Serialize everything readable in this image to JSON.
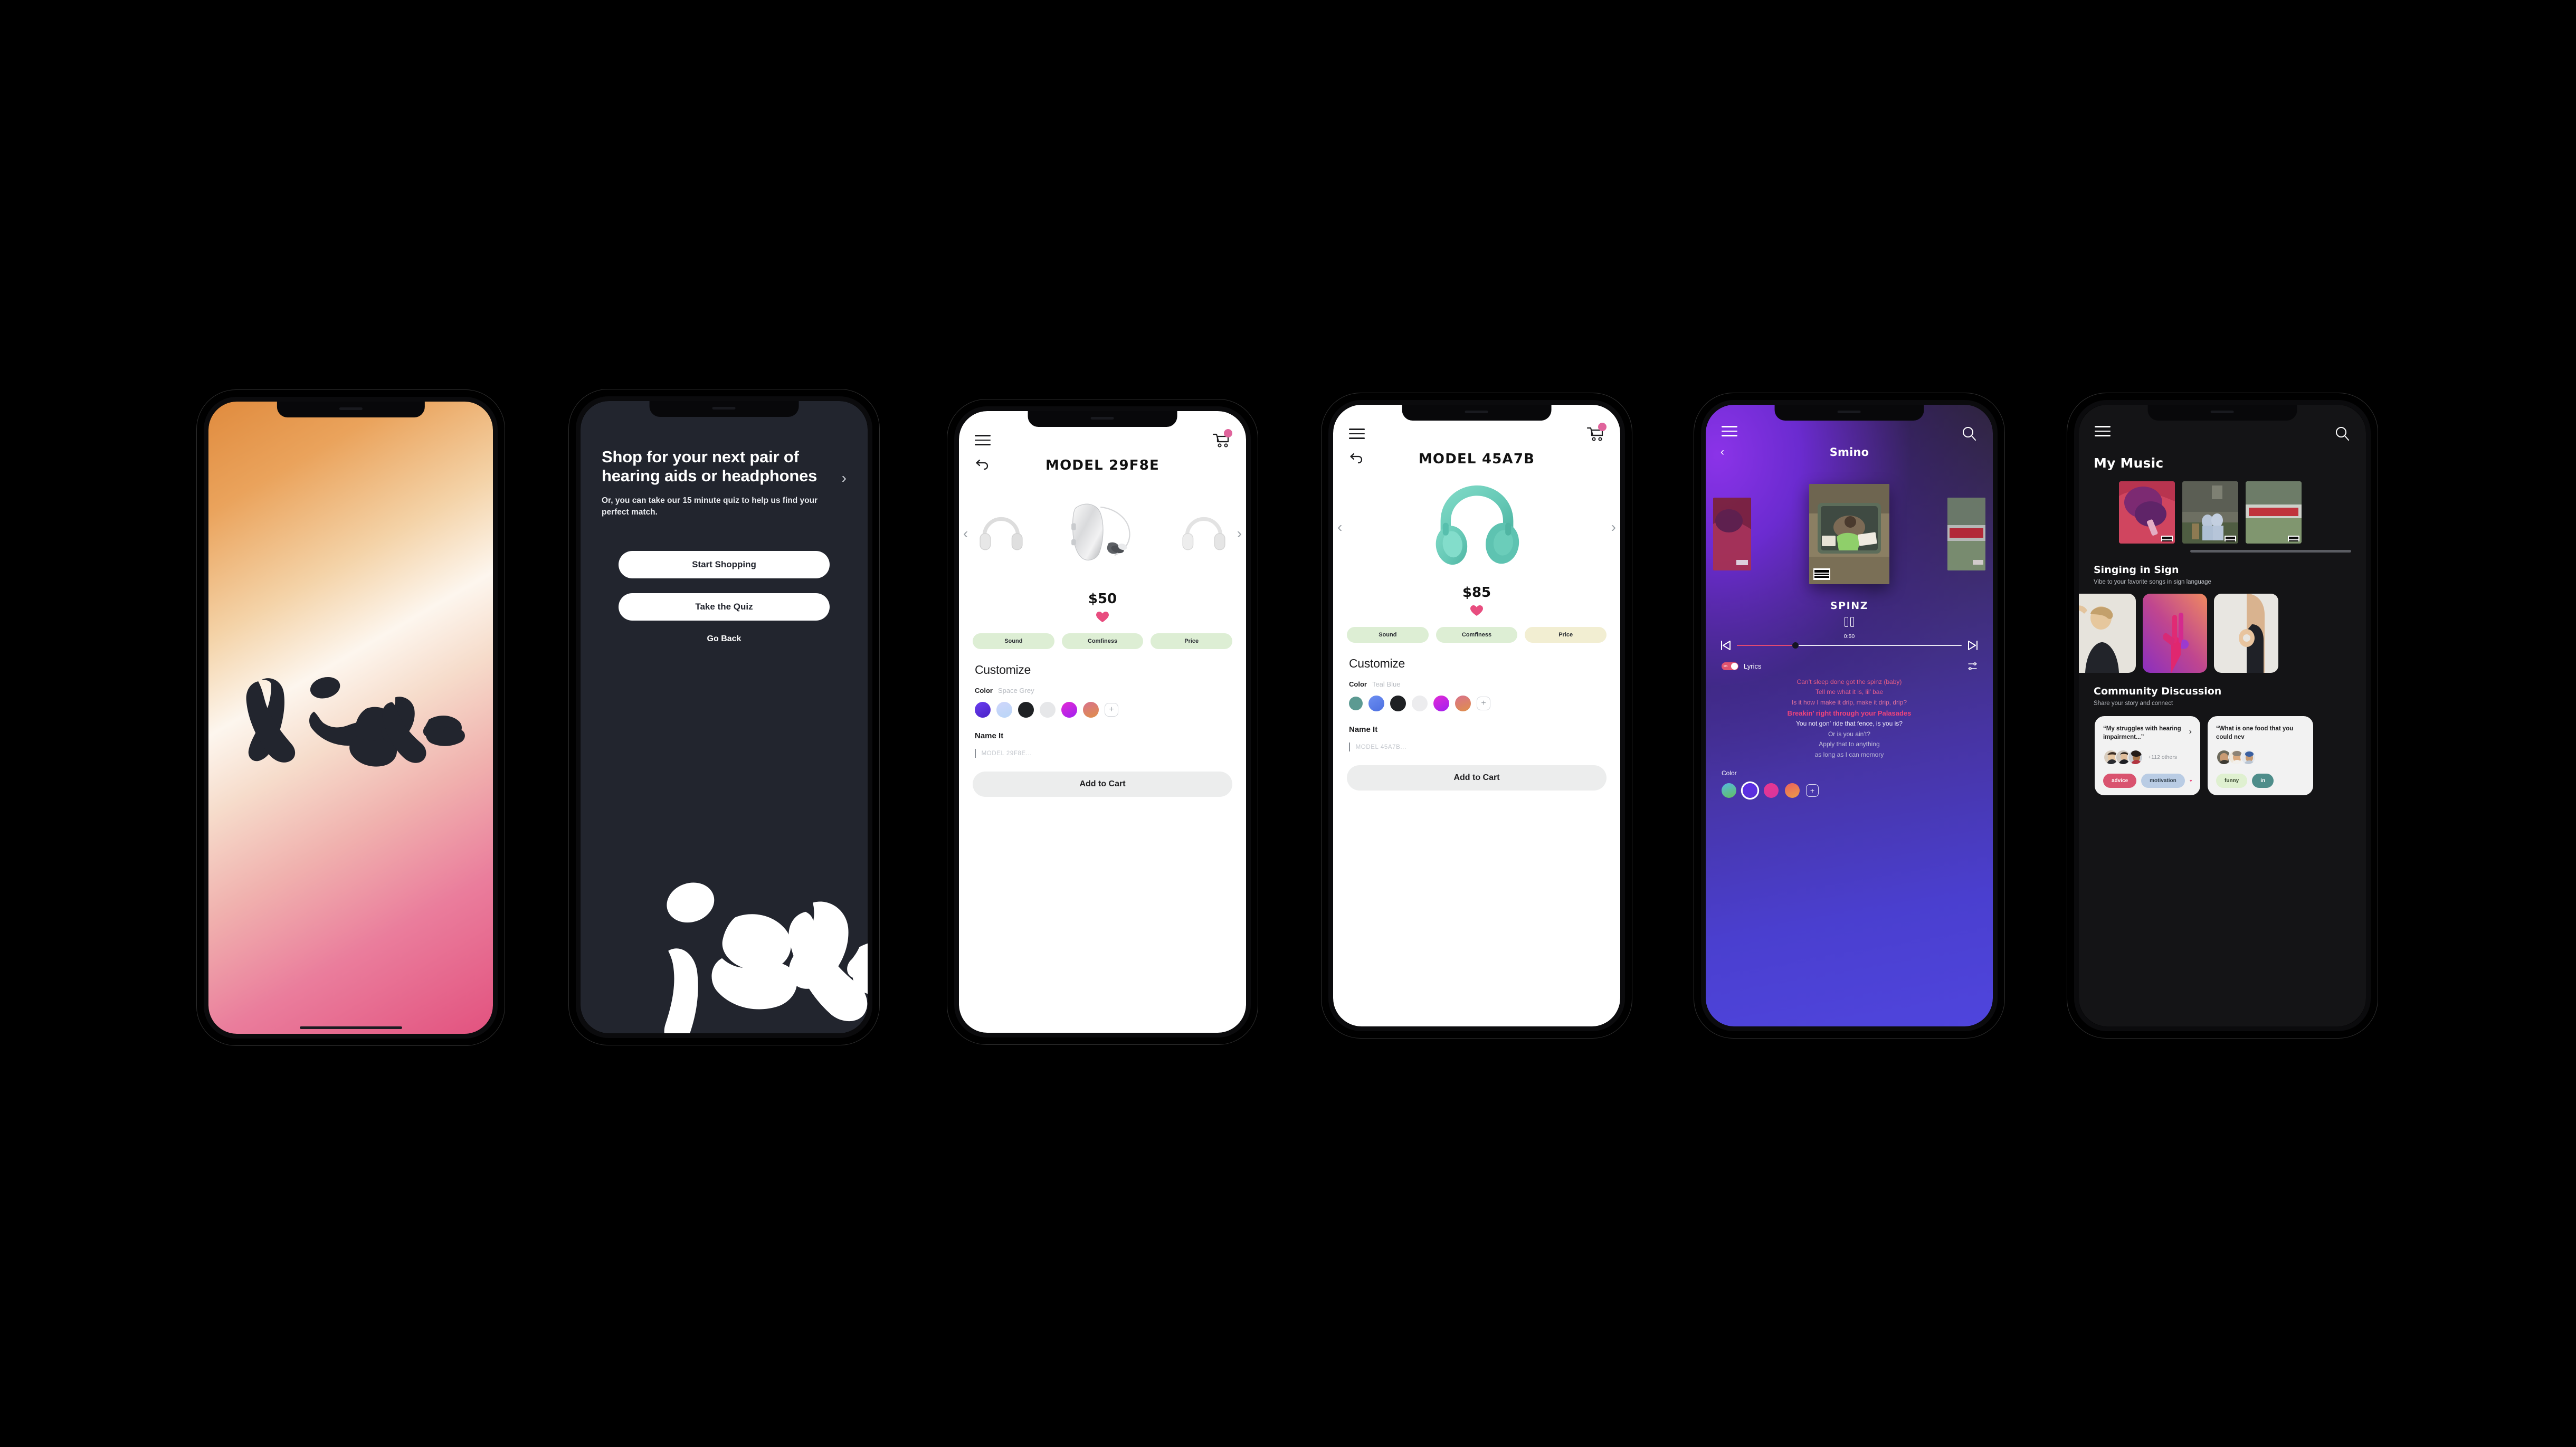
{
  "background_color": "#000000",
  "brand": {
    "logo_name": "vibe-wordmark-logo"
  },
  "phone1": {
    "name": "splash-screen",
    "gradient": [
      "#e08b3e",
      "#f4d3a8",
      "#fdf6ee",
      "#ea7d9c",
      "#e2527f"
    ],
    "logo_alt": "vibe"
  },
  "phone2": {
    "name": "onboarding-screen",
    "background": "#22252e",
    "title": "Shop for your next pair of hearing aids or headphones",
    "subtitle": "Or, you can take our 15 minute quiz to help us find your perfect match.",
    "primary_button": "Start Shopping",
    "secondary_button": "Take the Quiz",
    "tertiary_link": "Go Back",
    "chevron": "›"
  },
  "phone3": {
    "name": "product-detail-hearing-aid",
    "model_title": "MODEL 29F8E",
    "price": "$50",
    "cart_badge_color": "#e0649c",
    "heart_color": "#e84d7f",
    "feature_pills": [
      {
        "label": "Sound",
        "color": "#ddeed4"
      },
      {
        "label": "Comfiness",
        "color": "#ddeed4"
      },
      {
        "label": "Price",
        "color": "#ddeed4"
      }
    ],
    "customize_heading": "Customize",
    "color_label": "Color",
    "color_value": "Space Grey",
    "swatches": [
      "#5b31d8",
      "#c3cdf7",
      "#1f2124",
      "#e6e7e9",
      "#cf2ad8",
      "#d46f7a"
    ],
    "add_swatch_glyph": "+",
    "name_it_label": "Name It",
    "name_it_placeholder": "MODEL 29F8E...",
    "add_to_cart": "Add to Cart"
  },
  "phone4": {
    "name": "product-detail-headphones",
    "model_title": "MODEL 45A7B",
    "price": "$85",
    "cart_badge_color": "#e0649c",
    "heart_color": "#e84d7f",
    "feature_pills": [
      {
        "label": "Sound",
        "color": "#ddeed4"
      },
      {
        "label": "Comfiness",
        "color": "#ddeed4"
      },
      {
        "label": "Price",
        "color": "#f2eed2"
      }
    ],
    "customize_heading": "Customize",
    "color_label": "Color",
    "color_value": "Teal Blue",
    "swatches": [
      "#5c9a92",
      "#5b7ce8",
      "#1f2124",
      "#ececee",
      "#cf2ad8",
      "#d46f7a"
    ],
    "add_swatch_glyph": "+",
    "name_it_label": "Name It",
    "name_it_placeholder": "MODEL 45A7B...",
    "add_to_cart": "Add to Cart"
  },
  "phone5": {
    "name": "music-player-screen",
    "artist": "Smino",
    "track": "SPINZ",
    "current_time": "0:50",
    "progress_percent": 26,
    "lyrics_toggle_label": "Lyrics",
    "lyrics_toggle_state": "On",
    "lyrics": [
      {
        "text": "Can’t sleep done got the spinz (baby)",
        "style": "pink"
      },
      {
        "text": "Tell me what it is, lil’ bae",
        "style": "pink"
      },
      {
        "text": "Is it how I make it drip, make it drip, drip?",
        "style": "pink-soft"
      },
      {
        "text": "Breakin’ right through your Palasades",
        "style": "active"
      },
      {
        "text": "You not gon’ ride that fence, is you is?",
        "style": "white"
      },
      {
        "text": "Or is you ain’t?",
        "style": "dim"
      },
      {
        "text": "Apply that to anything",
        "style": "dim"
      },
      {
        "text": "as long as I can memory",
        "style": "dim"
      }
    ],
    "color_label": "Color",
    "swatches": [
      "#4fb0d8",
      "#5b31d8",
      "#e8368f",
      "#e97a54"
    ],
    "add_swatch_glyph": "+",
    "transport": {
      "prev": "skip-back",
      "play": "pause",
      "next": "skip-forward"
    }
  },
  "phone6": {
    "name": "my-music-screen",
    "page_title": "My Music",
    "section2_title": "Singing in Sign",
    "section2_subtitle": "Vibe to your favorite songs in sign language",
    "section3_title": "Community Discussion",
    "section3_subtitle": "Share your story and connect",
    "discussion_cards": [
      {
        "quote": "“My struggles with hearing impairment...”",
        "others": "+112 others",
        "tags": [
          {
            "label": "advice",
            "bg": "#d9536f",
            "fg": "#ffffff"
          },
          {
            "label": "motivation",
            "bg": "#b9cce4",
            "fg": "#33424f"
          }
        ],
        "has_heart": true,
        "chevron": "›"
      },
      {
        "quote": "“What is one food that you could nev",
        "others": "",
        "tags": [
          {
            "label": "funny",
            "bg": "#dff0d0",
            "fg": "#33422a"
          },
          {
            "label": "in",
            "bg": "#4e8d8a",
            "fg": "#ffffff"
          }
        ],
        "has_heart": false,
        "chevron": ""
      }
    ]
  },
  "icons": {
    "menu": "hamburger-icon",
    "search": "search-icon",
    "cart": "cart-icon",
    "undo": "undo-back-icon",
    "heart": "heart-icon",
    "mixer": "mixer-settings-icon"
  }
}
